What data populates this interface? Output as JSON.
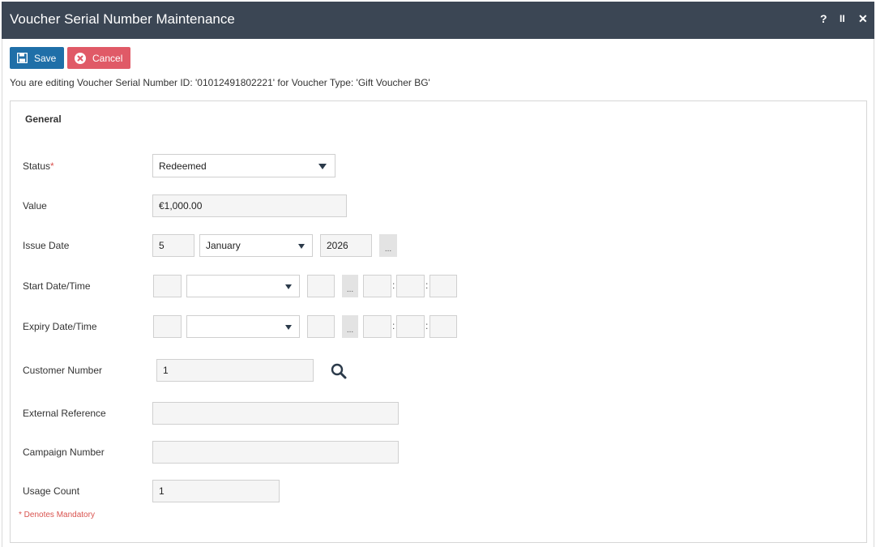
{
  "window": {
    "title": "Voucher Serial Number Maintenance",
    "help_label": "?",
    "pause_label": "II",
    "close_label": "✕"
  },
  "toolbar": {
    "save_label": "Save",
    "cancel_label": "Cancel"
  },
  "info_text": "You are editing Voucher Serial Number ID: '01012491802221' for Voucher Type: 'Gift Voucher BG'",
  "section": {
    "title": "General"
  },
  "fields": {
    "status": {
      "label": "Status",
      "required": "*",
      "value": "Redeemed"
    },
    "value": {
      "label": "Value",
      "value": "€1,000.00"
    },
    "issue_date": {
      "label": "Issue Date",
      "day": "5",
      "month": "January",
      "year": "2026",
      "picker": "..."
    },
    "start_datetime": {
      "label": "Start Date/Time",
      "day": "",
      "month": "",
      "year": "",
      "picker": "...",
      "hour": "",
      "minute": "",
      "second": "",
      "sep": ":"
    },
    "expiry_datetime": {
      "label": "Expiry Date/Time",
      "day": "",
      "month": "",
      "year": "",
      "picker": "...",
      "hour": "",
      "minute": "",
      "second": "",
      "sep": ":"
    },
    "customer_number": {
      "label": "Customer Number",
      "value": "1",
      "icon": "search-icon"
    },
    "external_reference": {
      "label": "External Reference",
      "value": ""
    },
    "campaign_number": {
      "label": "Campaign Number",
      "value": ""
    },
    "usage_count": {
      "label": "Usage Count",
      "value": "1"
    }
  },
  "footnote": "* Denotes Mandatory",
  "colors": {
    "titlebar": "#3b4654",
    "save": "#1f6fa8",
    "cancel": "#e05a67",
    "required": "#d9534f"
  }
}
